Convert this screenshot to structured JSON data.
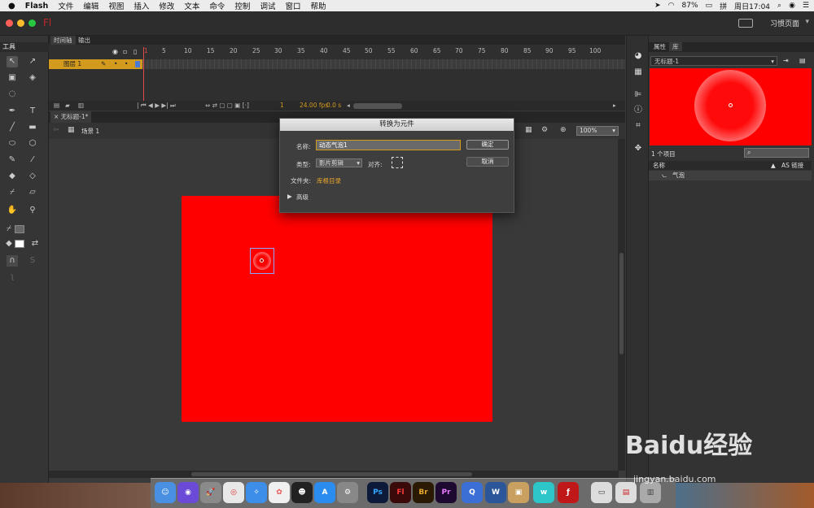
{
  "menubar": {
    "app": "Flash",
    "items": [
      "文件",
      "编辑",
      "视图",
      "插入",
      "修改",
      "文本",
      "命令",
      "控制",
      "调试",
      "窗口",
      "帮助"
    ],
    "battery": "87%",
    "clock": "周日17:04"
  },
  "titlebar": {
    "app_logo": "Fl",
    "workspace": "习惯页面"
  },
  "tools": {
    "tab_label": "工具"
  },
  "timeline": {
    "tabs": [
      "时间轴",
      "输出"
    ],
    "ruler": [
      "1",
      "5",
      "10",
      "15",
      "20",
      "25",
      "30",
      "35",
      "40",
      "45",
      "50",
      "55",
      "60",
      "65",
      "70",
      "75",
      "80",
      "85",
      "90",
      "95",
      "100"
    ],
    "layer_name": "图层 1",
    "current_frame": "1",
    "fps": "24.00 fps",
    "time": "0.0 s"
  },
  "document": {
    "tab": "无标题-1*",
    "scene": "场景 1",
    "zoom": "100%"
  },
  "stage": {
    "color": "#ff0000"
  },
  "dialog": {
    "title": "转换为元件",
    "name_label": "名称:",
    "name_value": "动态气泡1",
    "type_label": "类型:",
    "type_value": "影片剪辑",
    "align_label": "对齐:",
    "folder_label": "文件夹:",
    "folder_value": "库根目录",
    "advanced_label": "高级",
    "ok_label": "确定",
    "cancel_label": "取消"
  },
  "library": {
    "tabs": [
      "属性",
      "库"
    ],
    "document": "无标题-1",
    "count": "1 个项目",
    "col_name": "名称",
    "col_link": "AS 链接",
    "items": [
      "气泡"
    ]
  },
  "dock": {
    "apps": [
      "Ps",
      "Fl",
      "Br",
      "Pr",
      "W"
    ]
  },
  "watermark": {
    "main": "Baidu经验",
    "sub": "jingyan.baidu.com"
  }
}
